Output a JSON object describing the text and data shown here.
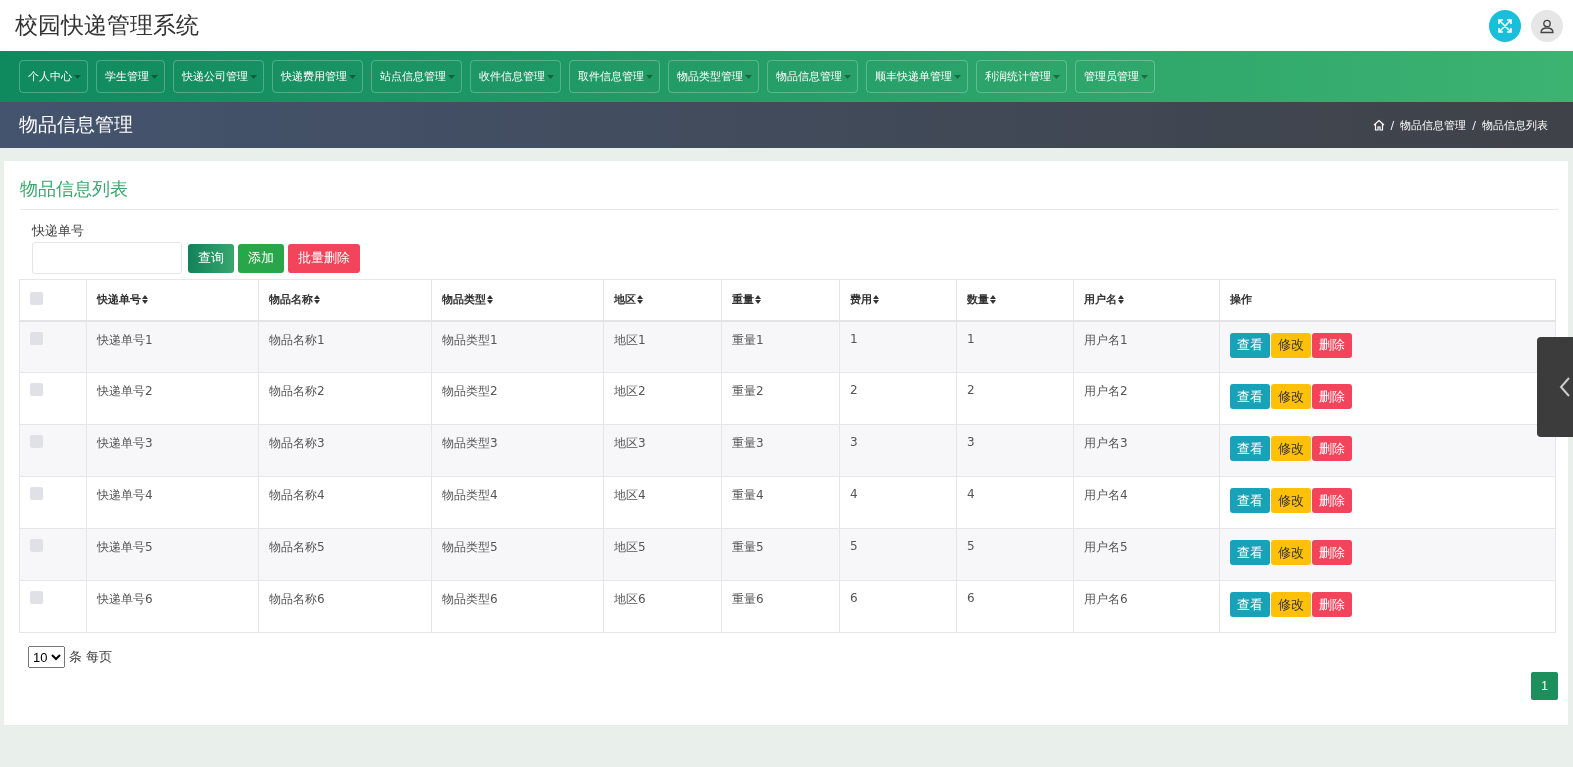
{
  "header": {
    "title": "校园快递管理系统"
  },
  "nav": [
    {
      "label": "个人中心"
    },
    {
      "label": "学生管理"
    },
    {
      "label": "快递公司管理"
    },
    {
      "label": "快递费用管理"
    },
    {
      "label": "站点信息管理"
    },
    {
      "label": "收件信息管理"
    },
    {
      "label": "取件信息管理"
    },
    {
      "label": "物品类型管理"
    },
    {
      "label": "物品信息管理"
    },
    {
      "label": "顺丰快递单管理"
    },
    {
      "label": "利润统计管理"
    },
    {
      "label": "管理员管理"
    }
  ],
  "banner": {
    "title": "物品信息管理",
    "breadcrumbs": [
      "物品信息管理",
      "物品信息列表"
    ],
    "separator": "/"
  },
  "panel": {
    "title": "物品信息列表",
    "search_label": "快递单号",
    "buttons": [
      {
        "label": "查询",
        "kind": "search"
      },
      {
        "label": "添加",
        "kind": "add"
      },
      {
        "label": "批量删除",
        "kind": "delete"
      }
    ]
  },
  "table": {
    "select_all": {
      "checked": false
    },
    "columns": [
      "快递单号",
      "物品名称",
      "物品类型",
      "地区",
      "重量",
      "费用",
      "数量",
      "用户名"
    ],
    "actions_header": "操作",
    "rows": [
      {
        "checked": false,
        "cells": [
          "快递单号1",
          "物品名称1",
          "物品类型1",
          "地区1",
          "重量1",
          "1",
          "1",
          "用户名1"
        ],
        "actions": [
          {
            "label": "查看",
            "kind": "view"
          },
          {
            "label": "修改",
            "kind": "edit"
          },
          {
            "label": "删除",
            "kind": "delete"
          }
        ]
      },
      {
        "checked": false,
        "cells": [
          "快递单号2",
          "物品名称2",
          "物品类型2",
          "地区2",
          "重量2",
          "2",
          "2",
          "用户名2"
        ],
        "actions": [
          {
            "label": "查看",
            "kind": "view"
          },
          {
            "label": "修改",
            "kind": "edit"
          },
          {
            "label": "删除",
            "kind": "delete"
          }
        ]
      },
      {
        "checked": false,
        "cells": [
          "快递单号3",
          "物品名称3",
          "物品类型3",
          "地区3",
          "重量3",
          "3",
          "3",
          "用户名3"
        ],
        "actions": [
          {
            "label": "查看",
            "kind": "view"
          },
          {
            "label": "修改",
            "kind": "edit"
          },
          {
            "label": "删除",
            "kind": "delete"
          }
        ]
      },
      {
        "checked": false,
        "cells": [
          "快递单号4",
          "物品名称4",
          "物品类型4",
          "地区4",
          "重量4",
          "4",
          "4",
          "用户名4"
        ],
        "actions": [
          {
            "label": "查看",
            "kind": "view"
          },
          {
            "label": "修改",
            "kind": "edit"
          },
          {
            "label": "删除",
            "kind": "delete"
          }
        ]
      },
      {
        "checked": false,
        "cells": [
          "快递单号5",
          "物品名称5",
          "物品类型5",
          "地区5",
          "重量5",
          "5",
          "5",
          "用户名5"
        ],
        "actions": [
          {
            "label": "查看",
            "kind": "view"
          },
          {
            "label": "修改",
            "kind": "edit"
          },
          {
            "label": "删除",
            "kind": "delete"
          }
        ]
      },
      {
        "checked": false,
        "cells": [
          "快递单号6",
          "物品名称6",
          "物品类型6",
          "地区6",
          "重量6",
          "6",
          "6",
          "用户名6"
        ],
        "actions": [
          {
            "label": "查看",
            "kind": "view"
          },
          {
            "label": "修改",
            "kind": "edit"
          },
          {
            "label": "删除",
            "kind": "delete"
          }
        ]
      }
    ]
  },
  "footer": {
    "page_size": "10",
    "page_size_label": "条 每页",
    "pages": [
      {
        "label": "1",
        "selected": true
      }
    ]
  }
}
